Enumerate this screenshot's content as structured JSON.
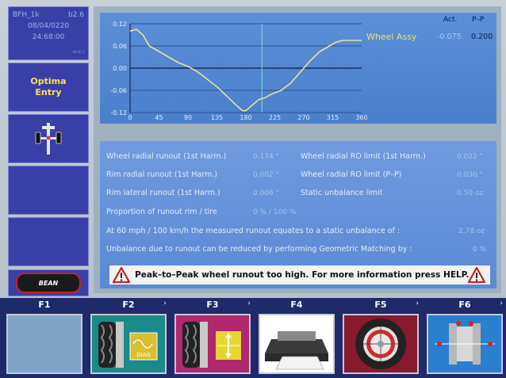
{
  "header": {
    "model": "BFH_1k",
    "version": "b2.6",
    "date": "08/04/0220",
    "time": "24:68:00",
    "wdc": "w.d.c"
  },
  "mode": {
    "line1": "Optima",
    "line2": "Entry"
  },
  "brand": {
    "logo_text": "BEAN"
  },
  "chart_panel": {
    "act_label": "Act.",
    "pp_label": "P–P",
    "wheel_assy_label": "Wheel Assy",
    "act_value": "-0.075",
    "pp_value": "0.200"
  },
  "chart_data": {
    "type": "line",
    "xlabel": "",
    "ylabel": "",
    "xlim": [
      0,
      360
    ],
    "ylim": [
      -0.12,
      0.12
    ],
    "x_ticks": [
      "0",
      "45",
      "90",
      "135",
      "180",
      "225",
      "270",
      "315",
      "360"
    ],
    "y_ticks": [
      "0.12",
      "0.06",
      "0.00",
      "-0.06",
      "-0.12"
    ],
    "cursor_x": 205,
    "x": [
      0,
      10,
      20,
      30,
      45,
      60,
      75,
      90,
      105,
      120,
      135,
      150,
      165,
      175,
      180,
      190,
      200,
      210,
      220,
      235,
      250,
      265,
      280,
      295,
      310,
      320,
      330,
      345,
      360
    ],
    "y": [
      0.1,
      0.105,
      0.09,
      0.06,
      0.045,
      0.03,
      0.015,
      0.005,
      -0.01,
      -0.03,
      -0.05,
      -0.075,
      -0.1,
      -0.115,
      -0.115,
      -0.1,
      -0.085,
      -0.08,
      -0.07,
      -0.06,
      -0.04,
      -0.01,
      0.02,
      0.045,
      0.06,
      0.07,
      0.075,
      0.075,
      0.075
    ]
  },
  "measurements": {
    "wheel_radial_label": "Wheel radial runout (1st Harm.)",
    "wheel_radial_value": "0.174 \"",
    "rim_radial_label": "Rim radial runout (1st Harm.)",
    "rim_radial_value": "0.002 \"",
    "rim_lateral_label": "Rim lateral runout (1st Harm.)",
    "rim_lateral_value": "0.006 \"",
    "proportion_label": "Proportion of runout rim / tire",
    "proportion_value": "0 % / 100 %",
    "limit1_label": "Wheel radial RO limit (1st Harm.)",
    "limit1_value": "0.022 \"",
    "limit2_label": "Wheel radial RO limit (P–P)",
    "limit2_value": "0.030 \"",
    "static_label": "Static unbalance limit",
    "static_value": "0.50 oz",
    "equates_label": "At 60 mph / 100 km/h the measured runout equates to a static unbalance of :",
    "equates_value": "2.78 oz",
    "reduce_label": "Unbalance due to runout can be reduced by performing Geometric Matching by :",
    "reduce_value": "0 %"
  },
  "warning": {
    "text": "Peak–to–Peak wheel runout too high. For more information press HELP."
  },
  "function_keys": [
    {
      "label": "F1"
    },
    {
      "label": "F2",
      "badge": "DIAG"
    },
    {
      "label": "F3"
    },
    {
      "label": "F4"
    },
    {
      "label": "F5"
    },
    {
      "label": "F6"
    }
  ],
  "colors": {
    "sidebar_bg": "#3a3fa8",
    "mode_text": "#ffe24a",
    "chart_bg": "#4f85d0",
    "curve": "#e9e29a",
    "cursor": "#7fe0d0",
    "fkey_bar": "#1e2a6a",
    "f2_bg": "#1a8a8a",
    "f3_bg": "#b0286e",
    "f5_bg": "#8a1a2e"
  }
}
